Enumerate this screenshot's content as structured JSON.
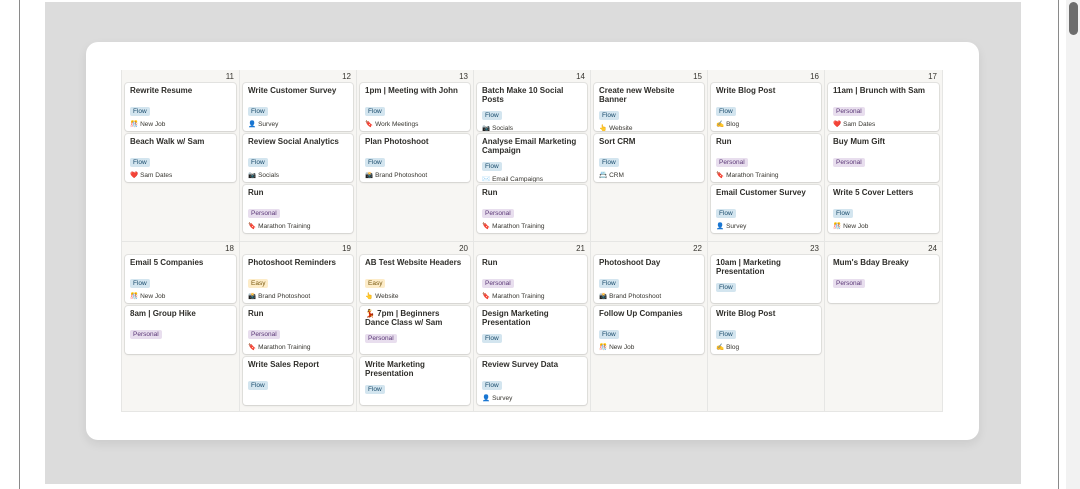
{
  "weeks": [
    {
      "days": [
        {
          "num": "11",
          "events": [
            {
              "title": "Rewrite Resume",
              "tag": "Flow",
              "project": "New Job",
              "icon": "🎊"
            },
            {
              "title": "Beach Walk w/ Sam",
              "tag": "Flow",
              "project": "Sam Dates",
              "icon": "❤️"
            }
          ]
        },
        {
          "num": "12",
          "events": [
            {
              "title": "Write Customer Survey",
              "tag": "Flow",
              "project": "Survey",
              "icon": "👤"
            },
            {
              "title": "Review Social Analytics",
              "tag": "Flow",
              "project": "Socials",
              "icon": "📷"
            },
            {
              "title": "Run",
              "tag": "Personal",
              "project": "Marathon Training",
              "icon": "🔖"
            }
          ]
        },
        {
          "num": "13",
          "events": [
            {
              "title": "1pm | Meeting with John",
              "tag": "Flow",
              "project": "Work Meetings",
              "icon": "🔖"
            },
            {
              "title": "Plan Photoshoot",
              "tag": "Flow",
              "project": "Brand Photoshoot",
              "icon": "📸"
            }
          ]
        },
        {
          "num": "14",
          "events": [
            {
              "title": "Batch Make 10 Social Posts",
              "tag": "Flow",
              "project": "Socials",
              "icon": "📷"
            },
            {
              "title": "Analyse Email Marketing Campaign",
              "tag": "Flow",
              "project": "Email Campaigns",
              "icon": "✉️"
            },
            {
              "title": "Run",
              "tag": "Personal",
              "project": "Marathon Training",
              "icon": "🔖"
            }
          ]
        },
        {
          "num": "15",
          "events": [
            {
              "title": "Create new Website Banner",
              "tag": "Flow",
              "project": "Website",
              "icon": "👆"
            },
            {
              "title": "Sort CRM",
              "tag": "Flow",
              "project": "CRM",
              "icon": "📇"
            }
          ]
        },
        {
          "num": "16",
          "events": [
            {
              "title": "Write Blog Post",
              "tag": "Flow",
              "project": "Blog",
              "icon": "✍️"
            },
            {
              "title": "Run",
              "tag": "Personal",
              "project": "Marathon Training",
              "icon": "🔖"
            },
            {
              "title": "Email Customer Survey",
              "tag": "Flow",
              "project": "Survey",
              "icon": "👤"
            }
          ]
        },
        {
          "num": "17",
          "events": [
            {
              "title": "11am | Brunch with Sam",
              "tag": "Personal",
              "project": "Sam Dates",
              "icon": "❤️"
            },
            {
              "title": "Buy Mum Gift",
              "tag": "Personal",
              "project": "",
              "icon": ""
            },
            {
              "title": "Write 5 Cover Letters",
              "tag": "Flow",
              "project": "New Job",
              "icon": "🎊"
            }
          ]
        }
      ]
    },
    {
      "days": [
        {
          "num": "18",
          "events": [
            {
              "title": "Email 5 Companies",
              "tag": "Flow",
              "project": "New Job",
              "icon": "🎊"
            },
            {
              "title": "8am | Group Hike",
              "tag": "Personal",
              "project": "",
              "icon": ""
            }
          ]
        },
        {
          "num": "19",
          "events": [
            {
              "title": "Photoshoot Reminders",
              "tag": "Easy",
              "project": "Brand Photoshoot",
              "icon": "📸"
            },
            {
              "title": "Run",
              "tag": "Personal",
              "project": "Marathon Training",
              "icon": "🔖"
            },
            {
              "title": "Write Sales Report",
              "tag": "Flow",
              "project": "",
              "icon": ""
            }
          ]
        },
        {
          "num": "20",
          "events": [
            {
              "title": "AB Test Website Headers",
              "tag": "Easy",
              "project": "Website",
              "icon": "👆"
            },
            {
              "title": "💃 7pm | Beginners Dance Class w/ Sam",
              "tag": "Personal",
              "project": "",
              "icon": ""
            },
            {
              "title": "Write Marketing Presentation",
              "tag": "Flow",
              "project": "",
              "icon": ""
            }
          ]
        },
        {
          "num": "21",
          "events": [
            {
              "title": "Run",
              "tag": "Personal",
              "project": "Marathon Training",
              "icon": "🔖"
            },
            {
              "title": "Design Marketing Presentation",
              "tag": "Flow",
              "project": "",
              "icon": ""
            },
            {
              "title": "Review Survey Data",
              "tag": "Flow",
              "project": "Survey",
              "icon": "👤"
            }
          ]
        },
        {
          "num": "22",
          "events": [
            {
              "title": "Photoshoot Day",
              "tag": "Flow",
              "project": "Brand Photoshoot",
              "icon": "📸"
            },
            {
              "title": "Follow Up Companies",
              "tag": "Flow",
              "project": "New Job",
              "icon": "🎊"
            }
          ]
        },
        {
          "num": "23",
          "events": [
            {
              "title": "10am | Marketing Presentation",
              "tag": "Flow",
              "project": "",
              "icon": ""
            },
            {
              "title": "Write Blog Post",
              "tag": "Flow",
              "project": "Blog",
              "icon": "✍️"
            }
          ]
        },
        {
          "num": "24",
          "events": [
            {
              "title": "Mum's Bday Breaky",
              "tag": "Personal",
              "project": "",
              "icon": ""
            }
          ]
        }
      ]
    }
  ]
}
